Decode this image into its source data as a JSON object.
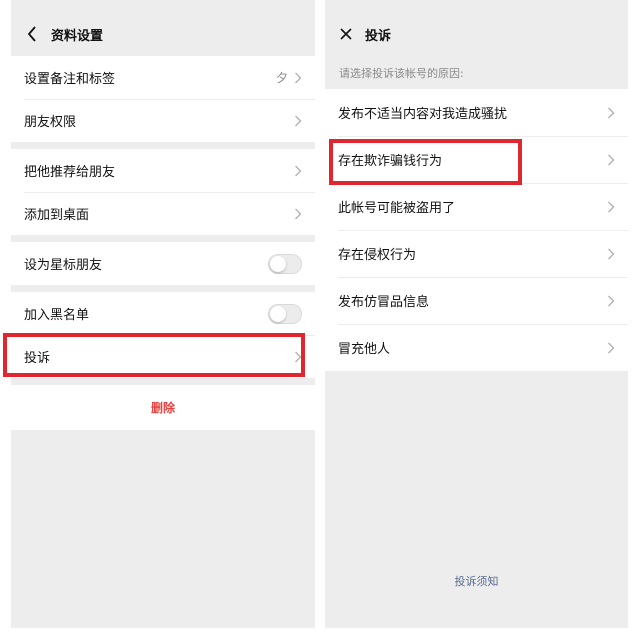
{
  "left": {
    "title": "资料设置",
    "groups": [
      [
        {
          "label": "设置备注和标签",
          "extra": "夕"
        },
        {
          "label": "朋友权限"
        }
      ],
      [
        {
          "label": "把他推荐给朋友"
        },
        {
          "label": "添加到桌面"
        }
      ],
      [
        {
          "label": "设为星标朋友",
          "toggle": false
        }
      ],
      [
        {
          "label": "加入黑名单",
          "toggle": false
        },
        {
          "label": "投诉"
        }
      ]
    ],
    "delete_label": "删除"
  },
  "right": {
    "title": "投诉",
    "hint": "请选择投诉该帐号的原因:",
    "reasons": [
      "发布不适当内容对我造成骚扰",
      "存在欺诈骗钱行为",
      "此帐号可能被盗用了",
      "存在侵权行为",
      "发布仿冒品信息",
      "冒充他人"
    ],
    "footer_link": "投诉须知"
  },
  "colors": {
    "highlight": "#e0262e",
    "danger": "#e64340",
    "link": "#576b95",
    "background": "#ededed"
  }
}
